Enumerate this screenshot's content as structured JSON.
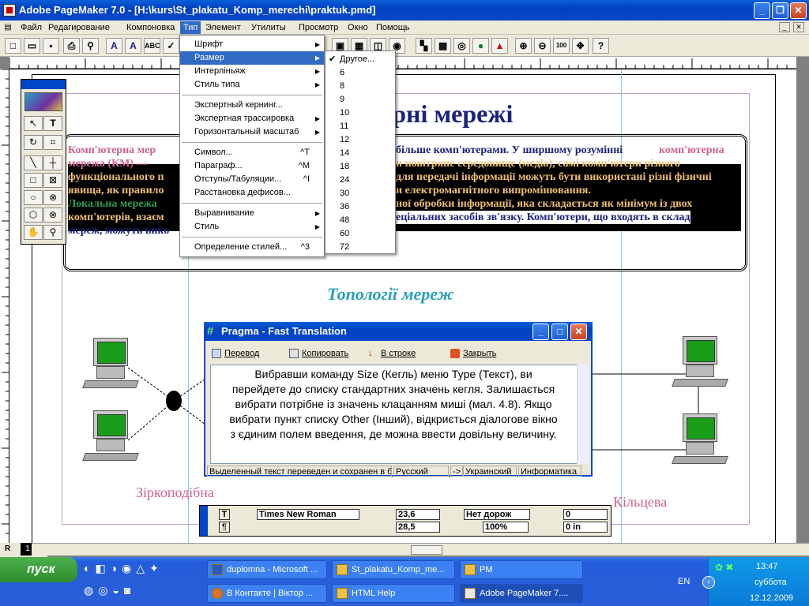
{
  "window": {
    "title": "Adobe PageMaker 7.0 - [H:\\kurs\\St_plakatu_Komp_merechi\\praktuk.pmd]"
  },
  "menubar": {
    "items": [
      "Файл",
      "Редагирование",
      "Компоновка",
      "Тип",
      "Элемент",
      "Утилиты",
      "Просмотр",
      "Окно",
      "Помощь"
    ]
  },
  "document": {
    "heading": "ерні  мережі",
    "para1": [
      {
        "pre": "Комп'ютерна мер",
        "post": "більше комп'ютерами. У ширшому розумінні ",
        "emph": "комп'ютерна"
      },
      {
        "pre": "мережа  (КМ) —",
        "post": "и повітряне середовище (медіа), самі комп'ютери різного"
      },
      {
        "pre": "функціонального п",
        "post": "для передачі інформації можуть бути використані різні фізичні"
      },
      {
        "pre": "явища, як правило",
        "post": "и електромагнітного випромінювання."
      },
      {
        "pre": "Локальна мережа",
        "post": "ної обробки інформації, яка складається як мінімум із двох"
      },
      {
        "pre": "комп'ютерів, взаєм",
        "post": "еціальних засобів зв'язку. Комп'ютери, що входять в склад"
      },
      {
        "pre": "мереж, можуть вико",
        "post": ""
      }
    ],
    "subheading": "Топології мереж",
    "label_star": "Зіркоподібна",
    "label_ring": "Кільцева"
  },
  "type_menu": {
    "items": [
      {
        "label": "Шрифт",
        "arrow": true
      },
      {
        "label": "Размер",
        "arrow": true,
        "selected": true
      },
      {
        "label": "Интерліньяж",
        "arrow": true
      },
      {
        "label": "Стиль типа",
        "arrow": true
      },
      {
        "sep": true
      },
      {
        "label": "Экспертный кернинг..."
      },
      {
        "label": "Экспертная трассировка",
        "arrow": true
      },
      {
        "label": "Горизонтальный масштаб",
        "arrow": true
      },
      {
        "sep": true
      },
      {
        "label": "Символ...",
        "shortcut": "^T"
      },
      {
        "label": "Параграф...",
        "shortcut": "^M"
      },
      {
        "label": "Отступы/Табуляции...",
        "shortcut": "^I"
      },
      {
        "label": "Расстановка дефисов..."
      },
      {
        "sep": true
      },
      {
        "label": "Выравнивание",
        "arrow": true
      },
      {
        "label": "Стиль",
        "arrow": true
      },
      {
        "sep": true
      },
      {
        "label": "Определение стилей...",
        "shortcut": "^3"
      }
    ]
  },
  "size_menu": {
    "items": [
      "Другое...",
      "6",
      "8",
      "9",
      "10",
      "11",
      "12",
      "14",
      "18",
      "24",
      "30",
      "36",
      "48",
      "60",
      "72"
    ],
    "checked": "Другое..."
  },
  "pragma": {
    "title": "Pragma - Fast Translation",
    "buttons": [
      "Перевод",
      "Копировать",
      "В строке",
      "Закрыть"
    ],
    "text_lines": [
      "Вибравши команду Size (Кегль) меню Type (Текст), ви",
      "перейдете до списку стандартних значень кегля. Залишається",
      "вибрати потрібне із значень клацанням миші (мал. 4.8). Якщо",
      "вибрати пункт списку Other (Інший), відкриється діалогове вікно",
      "з єдиним полем введення, де можна ввести довільну величину."
    ],
    "status": [
      "Выделенный текст переведен и сохранен в б",
      "Русский",
      "->",
      "Украинский",
      "Информатика"
    ]
  },
  "control_palette": {
    "font": "Times New Roman",
    "size": "23,6",
    "leading": "28,5",
    "kern": "Нет дорож",
    "scale": "100%",
    "val1": "0",
    "val2": "0 in"
  },
  "taskbar": {
    "start": "пуск",
    "row1": [
      "duplomna - Microsoft ...",
      "St_plakatu_Komp_me...",
      "PM"
    ],
    "row2": [
      "В Контакте | Віктор ...",
      "HTML Help",
      "Adobe PageMaker 7...."
    ],
    "lang": "EN",
    "time": "13:47",
    "day": "суббота",
    "date": "12.12.2009"
  },
  "colors": {
    "accent": "#316ac5",
    "heading": "#1a237e",
    "pink": "#d06090",
    "teal": "#2aa0b8"
  }
}
